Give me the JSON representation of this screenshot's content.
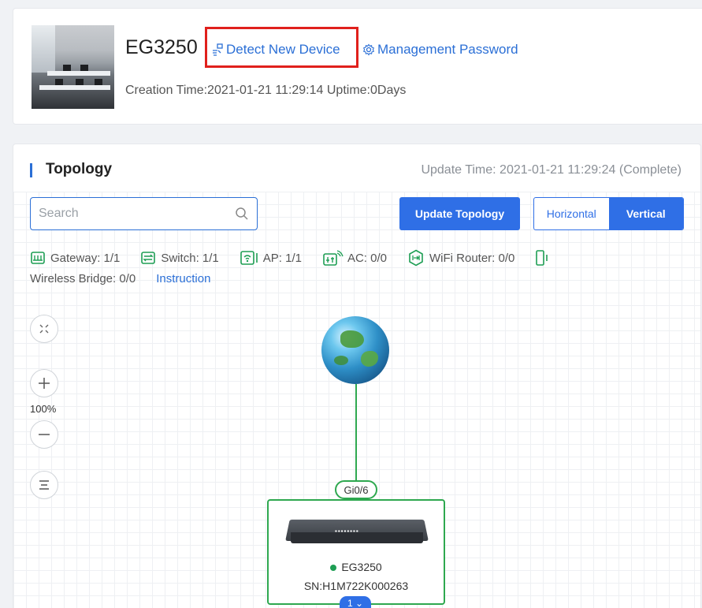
{
  "device": {
    "name": "EG3250",
    "detect_label": "Detect New Device",
    "detect_icon": "detect-device-icon",
    "mgmt_label": "Management Password",
    "mgmt_icon": "gear-icon",
    "creation_line": "Creation Time:2021-01-21 11:29:14 Uptime:0Days"
  },
  "topology": {
    "title": "Topology",
    "update_time": "Update Time: 2021-01-21 11:29:24 (Complete)",
    "search_placeholder": "Search",
    "update_button": "Update Topology",
    "view_horizontal": "Horizontal",
    "view_vertical": "Vertical",
    "selected_view": "Vertical",
    "legend": [
      {
        "icon": "gateway-icon",
        "label": "Gateway: 1/1"
      },
      {
        "icon": "switch-icon",
        "label": "Switch: 1/1"
      },
      {
        "icon": "ap-icon",
        "label": "AP: 1/1"
      },
      {
        "icon": "ac-icon",
        "label": "AC: 0/0"
      },
      {
        "icon": "wifi-router-icon",
        "label": "WiFi Router: 0/0"
      }
    ],
    "legend_row2": "Wireless Bridge: 0/0",
    "instruction": "Instruction",
    "zoom": "100%",
    "port": "Gi0/6",
    "node_name": "EG3250",
    "node_sn": "SN:H1M722K000263",
    "child_count": "1"
  },
  "colors": {
    "accent": "#2f6fe6",
    "online": "#1e9e54",
    "highlight": "#e0201c"
  }
}
